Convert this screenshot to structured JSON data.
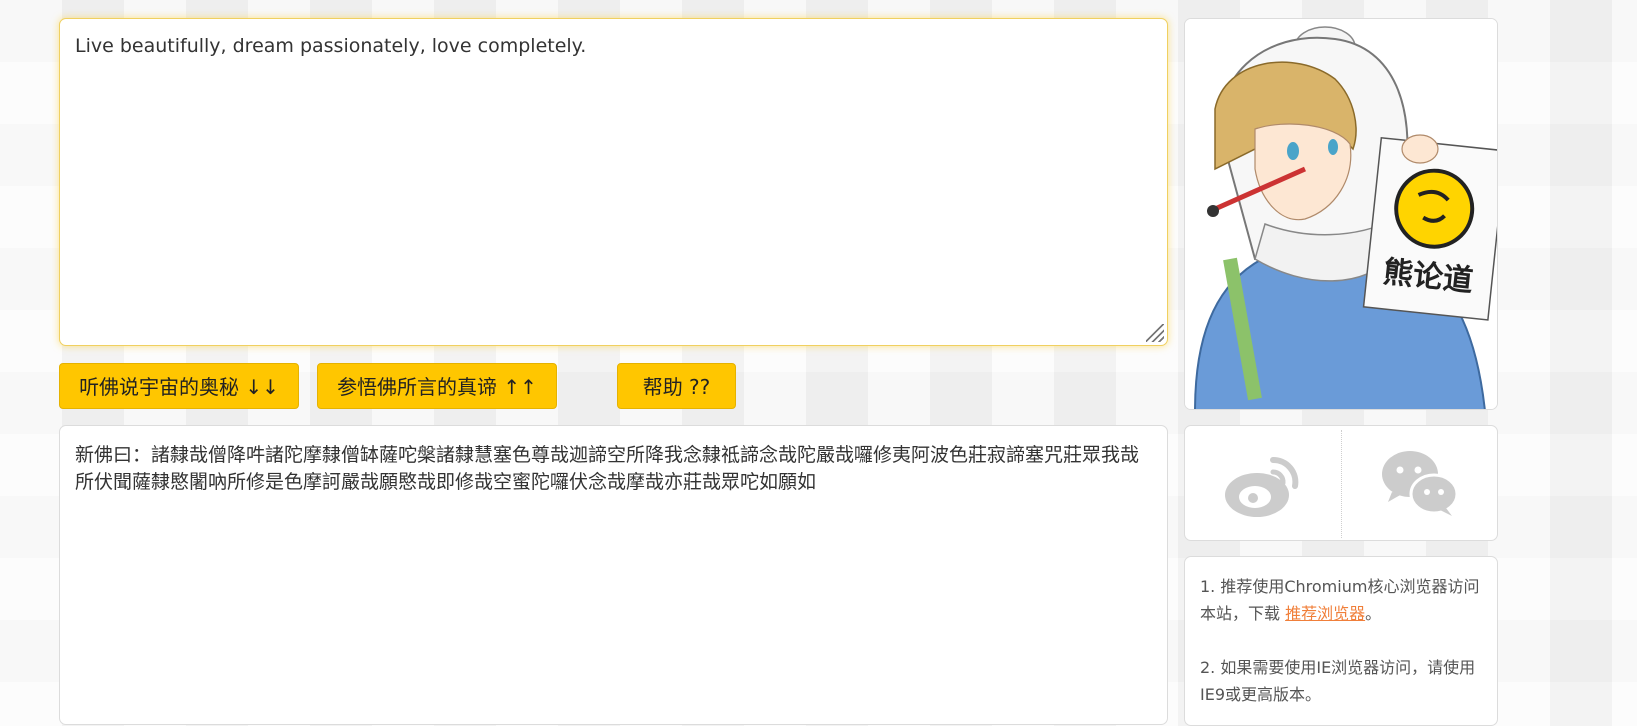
{
  "input": {
    "value": "Live beautifully, dream passionately, love completely."
  },
  "buttons": {
    "decode_label": "听佛说宇宙的奥秘 ↓↓",
    "encode_label": "参悟佛所言的真谛 ↑↑",
    "help_label": "帮助 ??"
  },
  "output": {
    "value": "新佛曰：諸隸哉僧降吽諸陀摩隸僧缽薩咜槃諸隸慧塞色尊哉迦諦空所降我念隸祗諦念哉陀嚴哉囉修夷阿波色莊寂諦塞咒莊眾我哉所伏聞薩隸愍闍吶所修是色摩訶嚴哉願愍哉即修哉空蜜陀囉伏念哉摩哉亦莊哉眾咜如願如"
  },
  "avatar": {
    "sign_text": "熊论道"
  },
  "share": {
    "weibo_icon": "weibo-icon",
    "wechat_icon": "wechat-icon"
  },
  "tips": {
    "tip1_text": "1. 推荐使用Chromium核心浏览器访问本站，下载 ",
    "tip1_link": "推荐浏览器",
    "tip1_end": "。",
    "tip2_text": "2. 如果需要使用IE浏览器访问，请使用IE9或更高版本。"
  },
  "colors": {
    "accent": "#ffc600",
    "link": "#f07f3a",
    "icon_gray": "#cccccc"
  }
}
